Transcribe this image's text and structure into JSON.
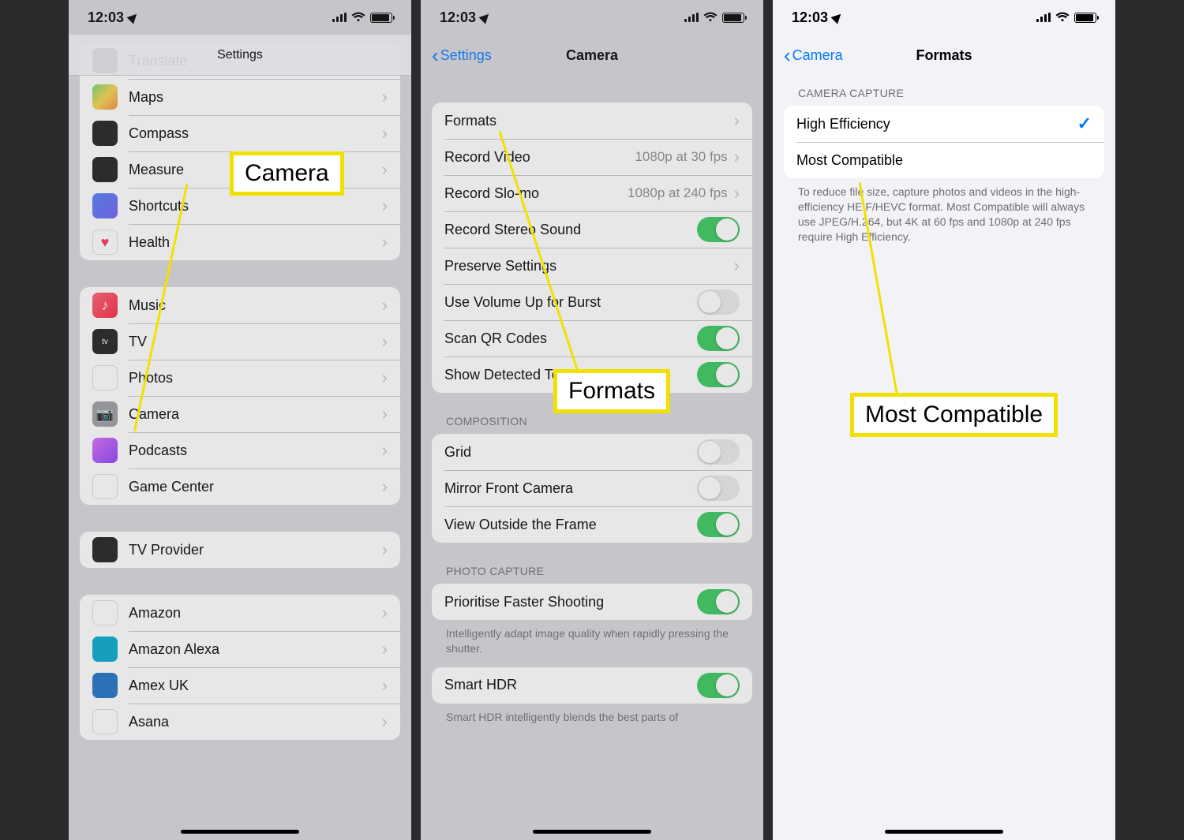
{
  "status": {
    "time": "12:03"
  },
  "screen1": {
    "title": "Settings",
    "group1": [
      {
        "label": "Translate",
        "icon": "ic-translate"
      },
      {
        "label": "Maps",
        "icon": "ic-maps"
      },
      {
        "label": "Compass",
        "icon": "ic-compass"
      },
      {
        "label": "Measure",
        "icon": "ic-measure"
      },
      {
        "label": "Shortcuts",
        "icon": "ic-shortcuts"
      },
      {
        "label": "Health",
        "icon": "ic-health"
      }
    ],
    "group2": [
      {
        "label": "Music",
        "icon": "ic-music"
      },
      {
        "label": "TV",
        "icon": "ic-tv"
      },
      {
        "label": "Photos",
        "icon": "ic-photos"
      },
      {
        "label": "Camera",
        "icon": "ic-camera"
      },
      {
        "label": "Podcasts",
        "icon": "ic-podcasts"
      },
      {
        "label": "Game Center",
        "icon": "ic-gamecenter"
      }
    ],
    "group3": [
      {
        "label": "TV Provider",
        "icon": "ic-tvprov"
      }
    ],
    "group4": [
      {
        "label": "Amazon",
        "icon": "ic-amazon"
      },
      {
        "label": "Amazon Alexa",
        "icon": "ic-alexa"
      },
      {
        "label": "Amex UK",
        "icon": "ic-amex"
      },
      {
        "label": "Asana",
        "icon": "ic-asana"
      }
    ],
    "callout": "Camera"
  },
  "screen2": {
    "back": "Settings",
    "title": "Camera",
    "group1": [
      {
        "label": "Formats",
        "type": "nav"
      },
      {
        "label": "Record Video",
        "detail": "1080p at 30 fps",
        "type": "nav"
      },
      {
        "label": "Record Slo-mo",
        "detail": "1080p at 240 fps",
        "type": "nav"
      },
      {
        "label": "Record Stereo Sound",
        "type": "toggle",
        "on": true
      },
      {
        "label": "Preserve Settings",
        "type": "nav"
      },
      {
        "label": "Use Volume Up for Burst",
        "type": "toggle",
        "on": false
      },
      {
        "label": "Scan QR Codes",
        "type": "toggle",
        "on": true
      },
      {
        "label": "Show Detected Text",
        "type": "toggle",
        "on": true
      }
    ],
    "sec2": "COMPOSITION",
    "group2": [
      {
        "label": "Grid",
        "type": "toggle",
        "on": false
      },
      {
        "label": "Mirror Front Camera",
        "type": "toggle",
        "on": false
      },
      {
        "label": "View Outside the Frame",
        "type": "toggle",
        "on": true
      }
    ],
    "sec3": "PHOTO CAPTURE",
    "group3": [
      {
        "label": "Prioritise Faster Shooting",
        "type": "toggle",
        "on": true
      }
    ],
    "foot3": "Intelligently adapt image quality when rapidly pressing the shutter.",
    "group4": [
      {
        "label": "Smart HDR",
        "type": "toggle",
        "on": true
      }
    ],
    "foot4": "Smart HDR intelligently blends the best parts of",
    "callout": "Formats"
  },
  "screen3": {
    "back": "Camera",
    "title": "Formats",
    "sec1": "CAMERA CAPTURE",
    "group1": [
      {
        "label": "High Efficiency",
        "checked": true
      },
      {
        "label": "Most Compatible",
        "checked": false
      }
    ],
    "foot1": "To reduce file size, capture photos and videos in the high-efficiency HEIF/HEVC format. Most Compatible will always use JPEG/H.264, but 4K at 60 fps and 1080p at 240 fps require High Efficiency.",
    "callout": "Most Compatible"
  }
}
